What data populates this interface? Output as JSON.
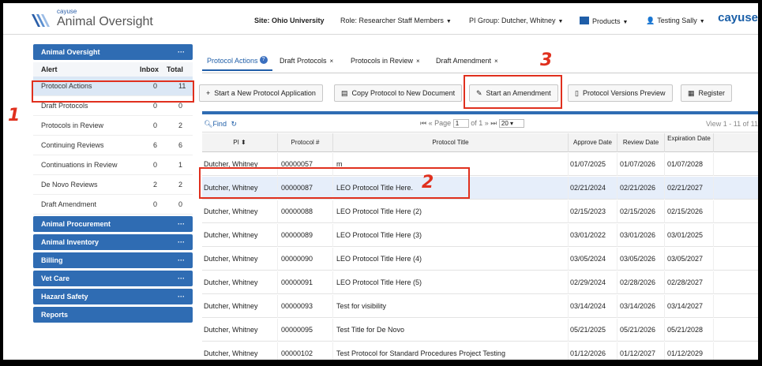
{
  "header": {
    "brand_small": "cayuse",
    "brand_big": "Animal Oversight",
    "site": "Site: Ohio University",
    "role": "Role: Researcher Staff Members",
    "pi_group": "PI Group: Dutcher, Whitney",
    "products": "Products",
    "user": "Testing Sally",
    "right_logo": "cayuse"
  },
  "sidebar": {
    "title": "Animal Oversight",
    "dots": "···",
    "col_alert": "Alert",
    "col_inbox": "Inbox",
    "col_total": "Total",
    "items": [
      {
        "label": "Protocol Actions",
        "inbox": "0",
        "total": "11"
      },
      {
        "label": "Draft Protocols",
        "inbox": "0",
        "total": "0"
      },
      {
        "label": "Protocols in Review",
        "inbox": "0",
        "total": "2"
      },
      {
        "label": "Continuing Reviews",
        "inbox": "6",
        "total": "6"
      },
      {
        "label": "Continuations in Review",
        "inbox": "0",
        "total": "1"
      },
      {
        "label": "De Novo Reviews",
        "inbox": "2",
        "total": "2"
      },
      {
        "label": "Draft Amendment",
        "inbox": "0",
        "total": "0"
      }
    ],
    "sections": [
      {
        "label": "Animal Procurement",
        "dots": "···"
      },
      {
        "label": "Animal Inventory",
        "dots": "···"
      },
      {
        "label": "Billing",
        "dots": "···"
      },
      {
        "label": "Vet Care",
        "dots": "···"
      },
      {
        "label": "Hazard Safety",
        "dots": "···"
      },
      {
        "label": "Reports",
        "dots": ""
      }
    ]
  },
  "tabs": [
    {
      "label": "Protocol Actions",
      "close": ""
    },
    {
      "label": "Draft Protocols",
      "close": "×"
    },
    {
      "label": "Protocols in Review",
      "close": "×"
    },
    {
      "label": "Draft Amendment",
      "close": "×"
    }
  ],
  "toolbar": {
    "start_new": "Start a New Protocol Application",
    "copy": "Copy Protocol to New Document",
    "amend": "Start an Amendment",
    "versions": "Protocol Versions Preview",
    "register": "Register"
  },
  "pager": {
    "find": "Find",
    "page_label": "Page",
    "page_value": "1",
    "of_label": "of 1",
    "per_page": "20",
    "view_info": "View 1 - 11 of 11"
  },
  "columns": {
    "pi": "PI",
    "protocol": "Protocol #",
    "title": "Protocol Title",
    "approve": "Approve Date",
    "review": "Review Date",
    "expiration": "Expiration Date"
  },
  "rows": [
    {
      "pi": "Dutcher, Whitney",
      "num": "00000057",
      "title": "m",
      "approve": "01/07/2025",
      "review": "01/07/2026",
      "exp": "01/07/2028"
    },
    {
      "pi": "Dutcher, Whitney",
      "num": "00000087",
      "title": "LEO Protocol Title Here.",
      "approve": "02/21/2024",
      "review": "02/21/2026",
      "exp": "02/21/2027"
    },
    {
      "pi": "Dutcher, Whitney",
      "num": "00000088",
      "title": "LEO Protocol Title Here (2)",
      "approve": "02/15/2023",
      "review": "02/15/2026",
      "exp": "02/15/2026"
    },
    {
      "pi": "Dutcher, Whitney",
      "num": "00000089",
      "title": "LEO Protocol Title Here (3)",
      "approve": "03/01/2022",
      "review": "03/01/2026",
      "exp": "03/01/2025"
    },
    {
      "pi": "Dutcher, Whitney",
      "num": "00000090",
      "title": "LEO Protocol Title Here (4)",
      "approve": "03/05/2024",
      "review": "03/05/2026",
      "exp": "03/05/2027"
    },
    {
      "pi": "Dutcher, Whitney",
      "num": "00000091",
      "title": "LEO Protocol Title Here (5)",
      "approve": "02/29/2024",
      "review": "02/28/2026",
      "exp": "02/28/2027"
    },
    {
      "pi": "Dutcher, Whitney",
      "num": "00000093",
      "title": "Test for visibility",
      "approve": "03/14/2024",
      "review": "03/14/2026",
      "exp": "03/14/2027"
    },
    {
      "pi": "Dutcher, Whitney",
      "num": "00000095",
      "title": "Test Title for De Novo",
      "approve": "05/21/2025",
      "review": "05/21/2026",
      "exp": "05/21/2028"
    },
    {
      "pi": "Dutcher, Whitney",
      "num": "00000102",
      "title": "Test Protocol for Standard Procedures Project Testing",
      "approve": "01/12/2026",
      "review": "01/12/2027",
      "exp": "01/12/2029"
    }
  ],
  "annotations": {
    "one": "1",
    "two": "2",
    "three": "3"
  },
  "colors": {
    "accent": "#2f6cb3",
    "annotation": "#e0301e"
  }
}
